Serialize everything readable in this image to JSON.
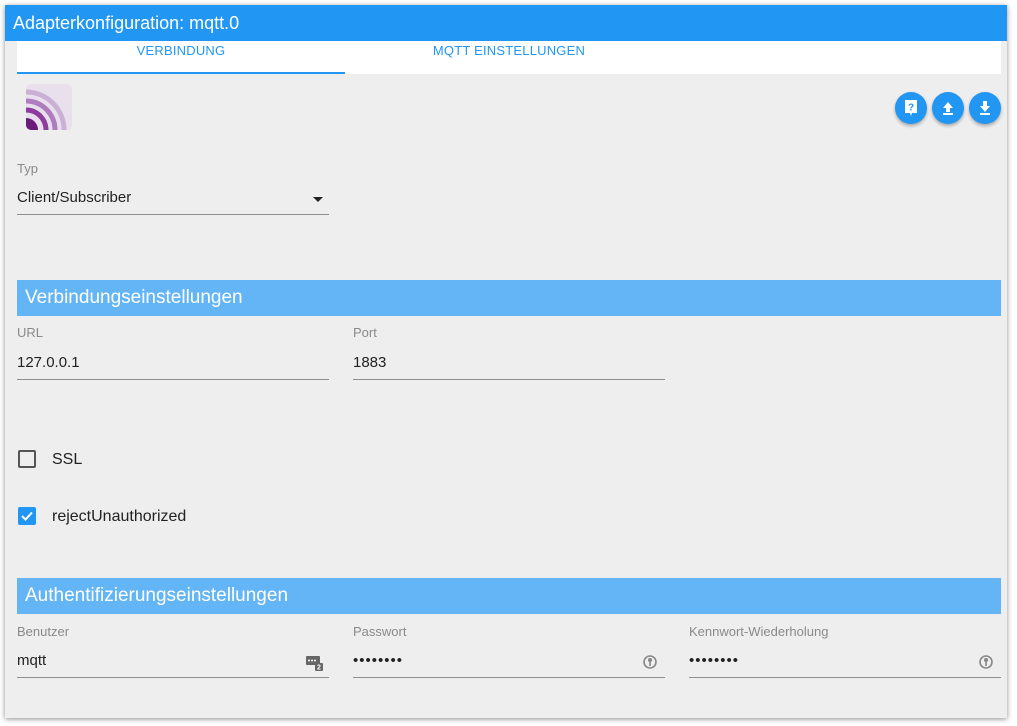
{
  "window": {
    "title": "Adapterkonfiguration: mqtt.0"
  },
  "tabs": [
    {
      "label": "VERBINDUNG",
      "active": true
    },
    {
      "label": "MQTT EINSTELLUNGEN",
      "active": false
    }
  ],
  "toolbar": {
    "help_icon": "help-book-icon",
    "upload_icon": "upload-icon",
    "download_icon": "download-icon"
  },
  "type_field": {
    "label": "Typ",
    "value": "Client/Subscriber"
  },
  "connection_section": {
    "title": "Verbindungseinstellungen",
    "url": {
      "label": "URL",
      "value": "127.0.0.1"
    },
    "port": {
      "label": "Port",
      "value": "1883"
    },
    "ssl": {
      "label": "SSL",
      "checked": false
    },
    "reject_unauthorized": {
      "label": "rejectUnauthorized",
      "checked": true
    }
  },
  "auth_section": {
    "title": "Authentifizierungseinstellungen",
    "user": {
      "label": "Benutzer",
      "value": "mqtt"
    },
    "password": {
      "label": "Passwort",
      "value": "••••••••"
    },
    "password_repeat": {
      "label": "Kennwort-Wiederholung",
      "value": "••••••••"
    }
  },
  "colors": {
    "primary": "#2196f3",
    "section": "#64b5f6",
    "background": "#eeeeee"
  }
}
